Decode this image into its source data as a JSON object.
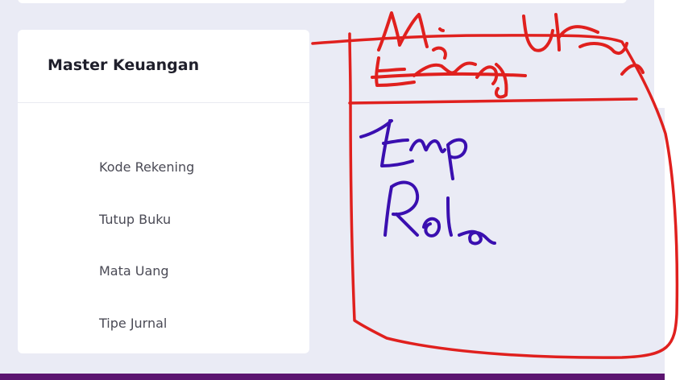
{
  "card": {
    "title": "Master Keuangan",
    "items": [
      {
        "label": "Kode Rekening"
      },
      {
        "label": "Tutup Buku"
      },
      {
        "label": "Mata Uang"
      },
      {
        "label": "Tipe Jurnal"
      }
    ]
  },
  "annotation": {
    "red_color": "#e0201e",
    "blue_color": "#3a0fb0",
    "handwritten_red_1": "My User",
    "handwritten_red_2": "Employee",
    "handwritten_blue_1": "Emp",
    "handwritten_blue_2": "Role"
  }
}
